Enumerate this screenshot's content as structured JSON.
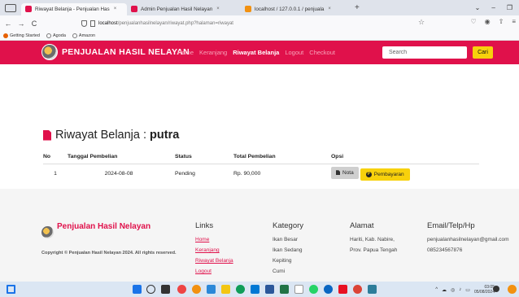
{
  "browser": {
    "tabs": [
      {
        "label": "Riwayat Belanja - Penjualan Has",
        "color": "#e0114b",
        "active": true
      },
      {
        "label": "Admin Penjualan Hasil Nelayan",
        "color": "#e0114b",
        "active": false
      },
      {
        "label": "localhost / 127.0.0.1 / penjuala",
        "color": "#f29111",
        "active": false
      }
    ],
    "url_host": "localhost",
    "url_path": "/penjualanhasilnelayan/riwayat.php?halaman=riwayat",
    "bookmarks": [
      {
        "label": "Getting Started",
        "color": "#e66000"
      },
      {
        "label": "Agoda",
        "color": "#7a7a7a"
      },
      {
        "label": "Amazon",
        "color": "#7a7a7a"
      }
    ],
    "icons": {
      "back": "←",
      "forward": "→",
      "reload": "C",
      "star": "☆",
      "close_tab": "×",
      "new_tab": "+"
    }
  },
  "site": {
    "brand": "PENJUALAN HASIL NELAYAN",
    "menu": [
      {
        "label": "Home",
        "active": false
      },
      {
        "label": "Keranjang",
        "active": false
      },
      {
        "label": "Riwayat Belanja",
        "active": true
      },
      {
        "label": "Logout",
        "active": false
      },
      {
        "label": "Checkout",
        "active": false
      }
    ],
    "search_placeholder": "Search",
    "search_button": "Cari",
    "accent_color": "#e0114b",
    "button_color": "#f7d10c"
  },
  "main": {
    "title": "Riwayat Belanja :",
    "username": "putra",
    "columns": [
      "No",
      "Tanggal Pembelian",
      "Status",
      "Total Pembelian",
      "Opsi"
    ],
    "rows": [
      {
        "no": "1",
        "tanggal": "2024-08-08",
        "status": "Pending",
        "total": "Rp. 90,000",
        "nota_label": "Nota",
        "bayar_label": "Pembayaran"
      }
    ]
  },
  "footer": {
    "brand": "Penjualan Hasil Nelayan",
    "copyright": "Copyright © Penjualan Hasil Nelayan 2024. All rights reserved.",
    "links_title": "Links",
    "links": [
      "Home",
      "Keranjang",
      "Riwayat Belanja",
      "Logout"
    ],
    "kategory_title": "Kategory",
    "kategory": [
      "Ikan Besar",
      "Ikan Sedang",
      "Kepiting",
      "Cumi"
    ],
    "alamat_title": "Alamat",
    "alamat": [
      "Hariti, Kab. Nabire,",
      "Prov. Papua Tengah"
    ],
    "contact_title": "Email/Telp/Hp",
    "contact": [
      "penjualanhasilnelayan@gmail.com",
      "085234567876"
    ]
  },
  "taskbar": {
    "time": "03:05",
    "date": "05/08/2024"
  }
}
